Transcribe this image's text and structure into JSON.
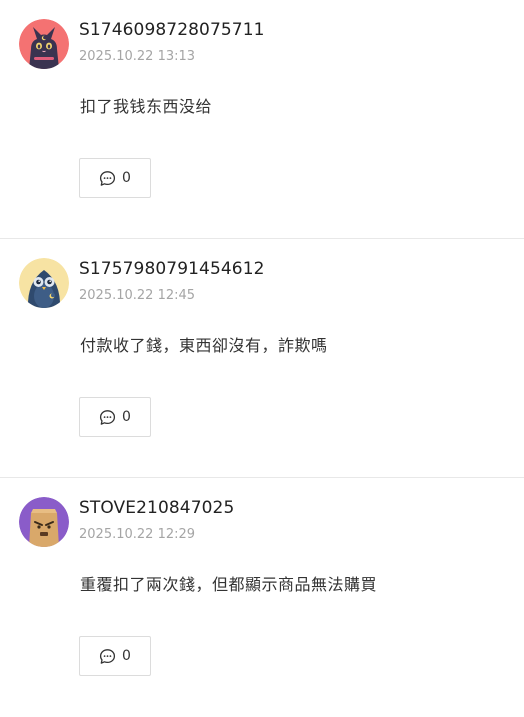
{
  "comments": [
    {
      "username": "S1746098728075711",
      "timestamp": "2025.10.22 13:13",
      "text": "扣了我钱东西没给",
      "reply_count": "0",
      "avatar": "black-cat-avatar-on-coral",
      "avatar_color": "#f47272"
    },
    {
      "username": "S1757980791454612",
      "timestamp": "2025.10.22 12:45",
      "text": "付款收了錢，東西卻沒有，詐欺嗎",
      "reply_count": "0",
      "avatar": "penguin-avatar-on-yellow",
      "avatar_color": "#f7e3a3"
    },
    {
      "username": "STOVE210847025",
      "timestamp": "2025.10.22 12:29",
      "text": "重覆扣了兩次錢，但都顯示商品無法購買",
      "reply_count": "0",
      "avatar": "angry-box-avatar-on-purple",
      "avatar_color": "#8a5cc9"
    }
  ],
  "icons": {
    "reply": "speech-bubble-icon"
  }
}
